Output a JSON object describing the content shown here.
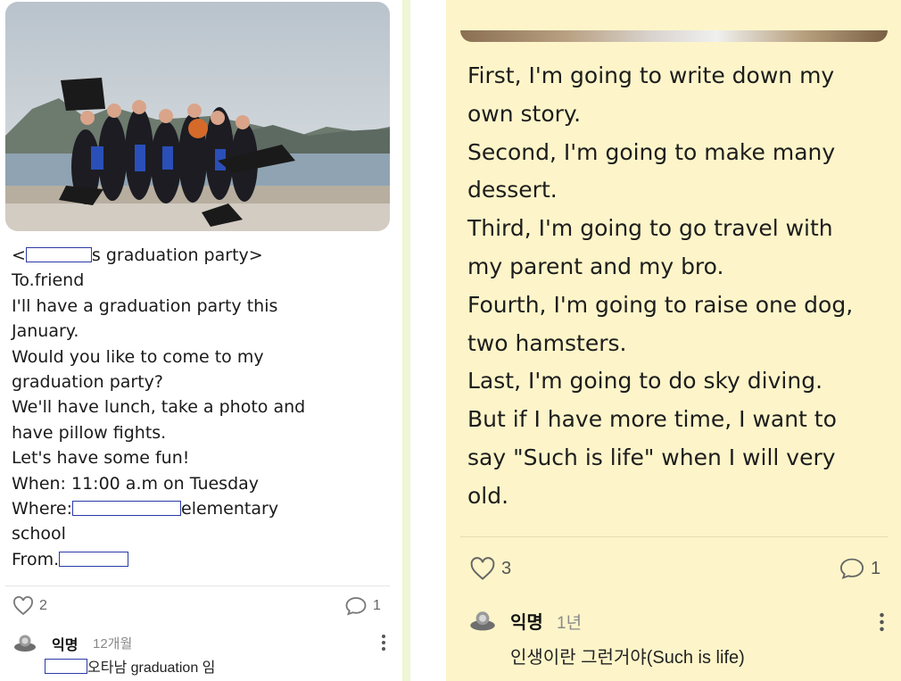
{
  "left_post": {
    "text_lines": [
      {
        "pre": "<",
        "redacted": true,
        "post": "s graduation party>"
      },
      {
        "text": "To.friend"
      },
      {
        "text": "I'll have a graduation party this"
      },
      {
        "text": "January."
      },
      {
        "text": "Would you like to come to my"
      },
      {
        "text": "graduation party?"
      },
      {
        "text": "We'll have lunch, take a photo and"
      },
      {
        "text": "have pillow fights."
      },
      {
        "text": "Let's have some fun!"
      },
      {
        "text": "When: 11:00 a.m on Tuesday"
      },
      {
        "pre": "Where:",
        "redacted": true,
        "post": "elementary"
      },
      {
        "text": "school"
      },
      {
        "pre": "From.",
        "redacted": true,
        "post": ""
      }
    ],
    "likes": "2",
    "comments": "1",
    "comment": {
      "author": "익명",
      "time": "12개월",
      "text": "오타남 graduation 임"
    }
  },
  "right_post": {
    "text_lines": [
      "First, I'm going to write down my",
      "own story.",
      "Second, I'm going to make many",
      "dessert.",
      "Third, I'm going to go travel with",
      "my parent and my bro.",
      "Fourth, I'm going to raise one dog,",
      "two hamsters.",
      "Last, I'm going to do sky diving.",
      "But if I have more time, I want to",
      "say \"Such is life\" when I will very",
      "old."
    ],
    "likes": "3",
    "comments": "1",
    "comment": {
      "author": "익명",
      "time": "1년",
      "text": "인생이란 그런거야(Such is life)"
    }
  },
  "colors": {
    "right_card_bg": "#fdf5c9",
    "separator": "#eef6d4",
    "icon_gray": "#777777"
  },
  "icons": [
    "heart-icon",
    "comment-bubble-icon",
    "avatar-icon",
    "more-vertical-icon"
  ]
}
